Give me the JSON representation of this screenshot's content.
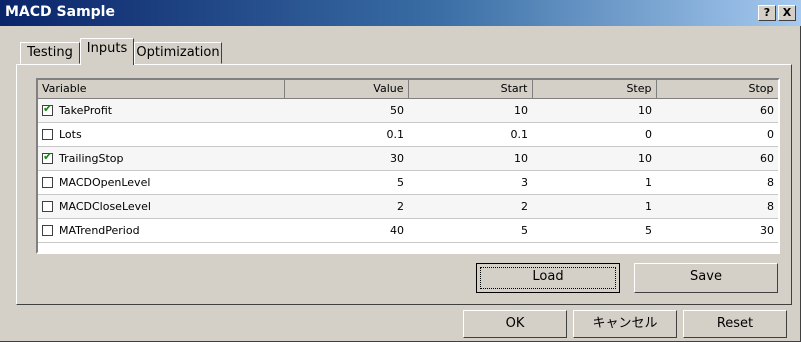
{
  "window": {
    "title": "MACD Sample",
    "help_label": "?",
    "close_label": "X"
  },
  "tabs": [
    {
      "label": "Testing",
      "active": false
    },
    {
      "label": "Inputs",
      "active": true
    },
    {
      "label": "Optimization",
      "active": false
    }
  ],
  "grid": {
    "columns": [
      "Variable",
      "Value",
      "Start",
      "Step",
      "Stop"
    ],
    "rows": [
      {
        "checked": true,
        "variable": "TakeProfit",
        "value": "50",
        "start": "10",
        "step": "10",
        "stop": "60"
      },
      {
        "checked": false,
        "variable": "Lots",
        "value": "0.1",
        "start": "0.1",
        "step": "0",
        "stop": "0"
      },
      {
        "checked": true,
        "variable": "TrailingStop",
        "value": "30",
        "start": "10",
        "step": "10",
        "stop": "60"
      },
      {
        "checked": false,
        "variable": "MACDOpenLevel",
        "value": "5",
        "start": "3",
        "step": "1",
        "stop": "8"
      },
      {
        "checked": false,
        "variable": "MACDCloseLevel",
        "value": "2",
        "start": "2",
        "step": "1",
        "stop": "8"
      },
      {
        "checked": false,
        "variable": "MATrendPeriod",
        "value": "40",
        "start": "5",
        "step": "5",
        "stop": "30"
      }
    ]
  },
  "panel_buttons": {
    "load": "Load",
    "save": "Save"
  },
  "dialog_buttons": {
    "ok": "OK",
    "cancel": "キャンセル",
    "reset": "Reset"
  },
  "colors": {
    "title_start": "#0a246a",
    "title_end": "#a6caf0",
    "check": "#0a8a0a",
    "face": "#d4d0c8"
  }
}
